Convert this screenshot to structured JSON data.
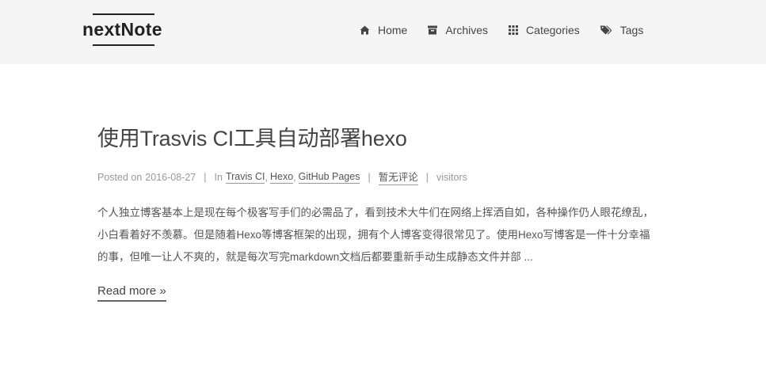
{
  "site": {
    "logo": "nextNote"
  },
  "nav": {
    "items": [
      {
        "label": "Home",
        "icon": "home-icon"
      },
      {
        "label": "Archives",
        "icon": "archive-icon"
      },
      {
        "label": "Categories",
        "icon": "th-grid-icon"
      },
      {
        "label": "Tags",
        "icon": "tags-icon"
      }
    ]
  },
  "post": {
    "title": "使用Trasvis CI工具自动部署hexo",
    "meta": {
      "posted_on_label": "Posted on",
      "date": "2016-08-27",
      "in_label": "In",
      "categories": [
        "Travis CI",
        "Hexo",
        "GitHub Pages"
      ],
      "comments": "暂无评论",
      "visitors": "visitors"
    },
    "excerpt": "个人独立博客基本上是现在每个极客写手们的必需品了，看到技术大牛们在网络上挥洒自如，各种操作仍人眼花缭乱，小白看着好不羡慕。但是随着Hexo等博客框架的出现，拥有个人博客变得很常见了。使用Hexo写博客是一件十分幸福的事，但唯一让人不爽的，就是每次写完markdown文档后都要重新手动生成静态文件并部 ...",
    "read_more": "Read more »"
  }
}
